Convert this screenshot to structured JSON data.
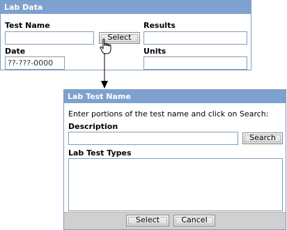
{
  "lab_data": {
    "title": "Lab Data",
    "test_name_label": "Test Name",
    "test_name_value": "",
    "select_button": "Select",
    "results_label": "Results",
    "results_value": "",
    "date_label": "Date",
    "date_value": "??-???-0000",
    "units_label": "Units",
    "units_value": ""
  },
  "dialog": {
    "title": "Lab Test Name",
    "instruction": "Enter portions of the test name and click on Search:",
    "description_label": "Description",
    "description_value": "",
    "search_button": "Search",
    "types_label": "Lab Test Types",
    "select_button": "Select",
    "cancel_button": "Cancel"
  },
  "icons": [
    "hand-pointer-icon",
    "arrow-down-icon"
  ],
  "colors": {
    "header_bg": "#7fa1cf",
    "header_text": "#ffffff",
    "border": "#7a9cc4",
    "footer_bg": "#d0d0d0"
  }
}
